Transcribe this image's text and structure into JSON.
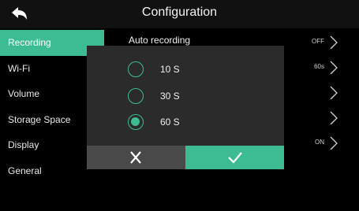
{
  "header": {
    "title": "Configuration",
    "back_icon": "back-arrow-icon"
  },
  "sidebar": {
    "items": [
      {
        "label": "Recording",
        "active": true
      },
      {
        "label": "Wi-Fi",
        "active": false
      },
      {
        "label": "Volume",
        "active": false
      },
      {
        "label": "Storage Space",
        "active": false
      },
      {
        "label": "Display",
        "active": false
      },
      {
        "label": "General",
        "active": false
      }
    ]
  },
  "content": {
    "rows": [
      {
        "label": "Auto recording",
        "value": "OFF"
      },
      {
        "label": "",
        "value": "60s"
      },
      {
        "label": "",
        "value": ""
      },
      {
        "label": "",
        "value": ""
      },
      {
        "label": "",
        "value": "ON"
      }
    ]
  },
  "dialog": {
    "options": [
      {
        "label": "10 S",
        "selected": false
      },
      {
        "label": "30 S",
        "selected": false
      },
      {
        "label": "60 S",
        "selected": true
      }
    ],
    "cancel_icon": "close-icon",
    "confirm_icon": "check-icon"
  },
  "colors": {
    "accent": "#3dbb93",
    "dialog_bg": "#2b2b2b",
    "cancel_bg": "#4a4a4a"
  }
}
